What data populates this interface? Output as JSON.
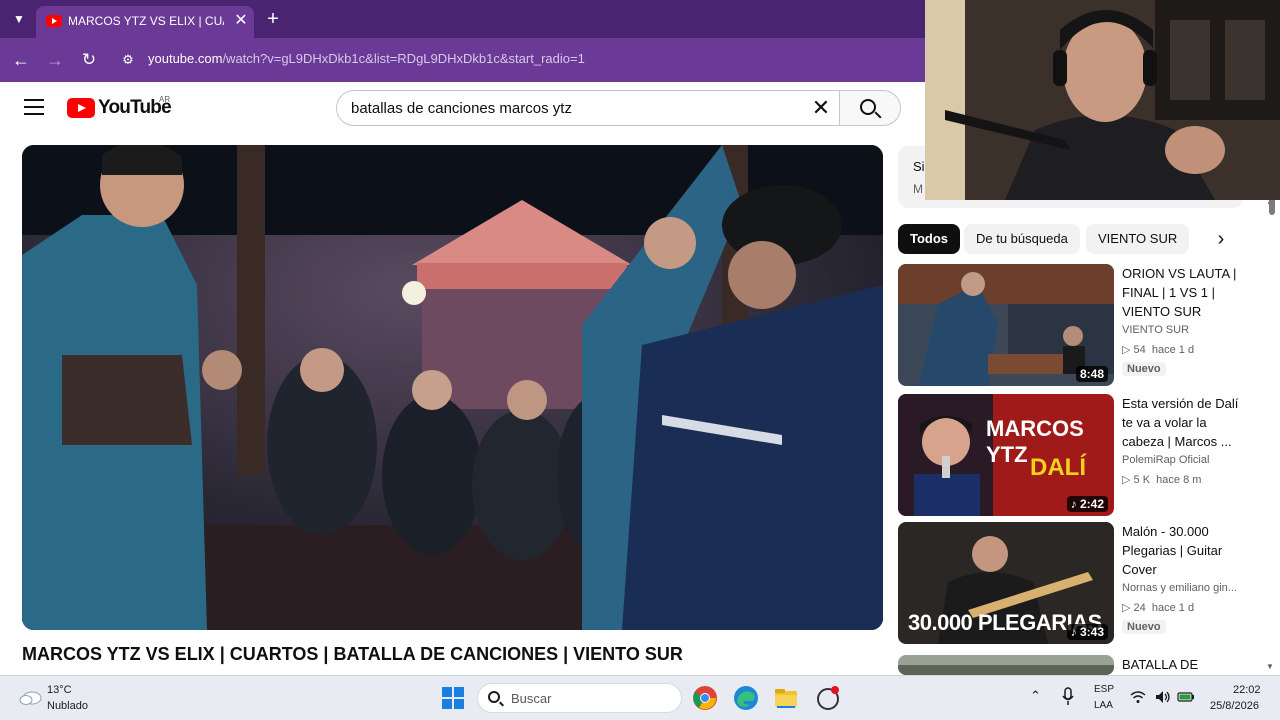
{
  "browser": {
    "tab_title": "MARCOS YTZ VS ELIX | CUARTOS | BATALLA DE CANCIONES | VIENTO SUR",
    "url_host": "youtube.com",
    "url_path": "/watch?v=gL9DHxDkb1c&list=RDgL9DHxDkb1c&start_radio=1"
  },
  "youtube": {
    "logo_text": "YouTube",
    "region": "AR",
    "search_value": "batallas de canciones marcos ytz"
  },
  "video": {
    "title": "MARCOS YTZ VS ELIX | CUARTOS | BATALLA DE CANCIONES | VIENTO SUR"
  },
  "sidebar": {
    "banner_line1": "Si",
    "banner_line2": "M",
    "chips": [
      "Todos",
      "De tu búsqueda",
      "VIENTO SUR"
    ],
    "recommendations": [
      {
        "title": "ORION VS LAUTA | FINAL | 1 VS 1 | VIENTO SUR",
        "channel": "VIENTO SUR",
        "views": "54",
        "age": "hace 1 d",
        "badge": "Nuevo",
        "duration": "8:48"
      },
      {
        "title": "Esta versión de Dalí te va a volar la cabeza | Marcos ...",
        "channel": "PolemiRap Oficial",
        "views": "5 K",
        "age": "hace 8 m",
        "badge": "",
        "duration": "2:42",
        "thumb_text1": "MARCOS YTZ",
        "thumb_text2": "DALÍ"
      },
      {
        "title": "Malón - 30.000 Plegarias | Guitar Cover",
        "channel": "Nornas  y emiliano gin...",
        "views": "24",
        "age": "hace 1 d",
        "badge": "Nuevo",
        "duration": "3:43",
        "thumb_text1": "30.000 PLEGARIAS"
      },
      {
        "title": "BATALLA DE"
      }
    ]
  },
  "taskbar": {
    "temperature": "13°C",
    "weather": "Nublado",
    "search_placeholder": "Buscar",
    "lang1": "ESP",
    "lang2": "LAA",
    "time": "22:02",
    "date": "25/8/2026"
  }
}
